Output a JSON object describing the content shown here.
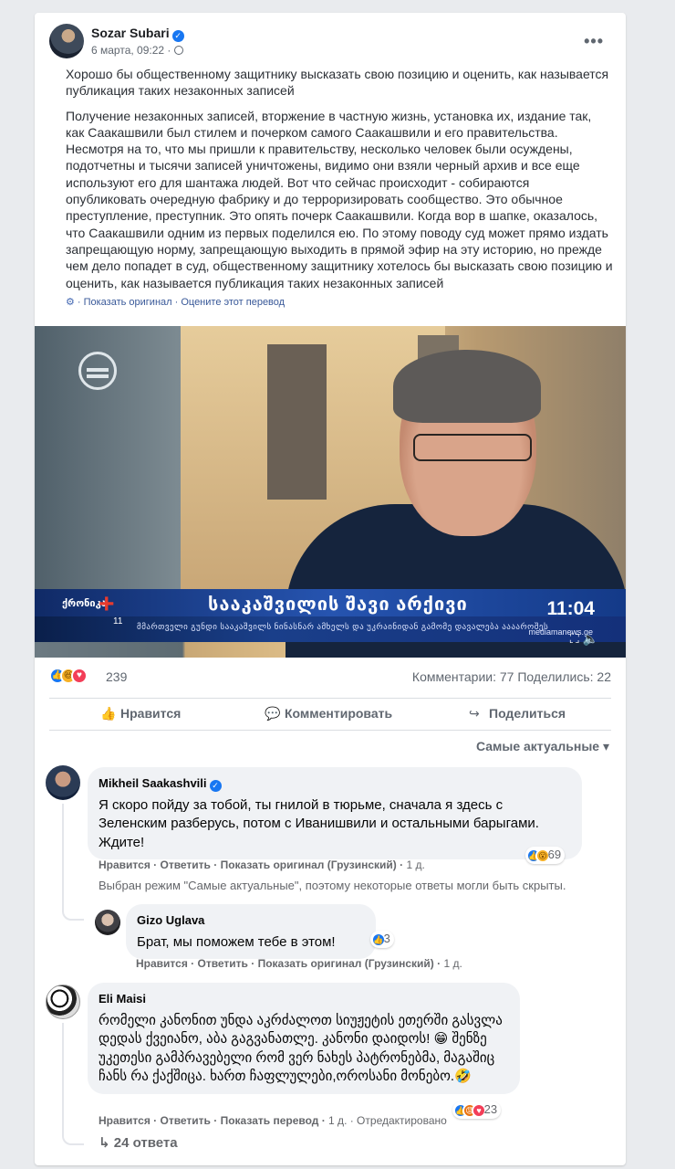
{
  "post": {
    "author": "Sozar Subari",
    "date": "6 марта, 09:22 ·",
    "more": "•••",
    "paragraph1": "Хорошо бы общественному защитнику высказать свою позицию и оценить, как называется публикация таких незаконных записей",
    "paragraph2": "Получение незаконных записей, вторжение в частную жизнь, установка их, издание так, как Саакашвили был стилем и почерком самого Саакашвили и его правительства. Несмотря на то, что мы пришли к правительству, несколько человек были осуждены, подотчетны и тысячи записей уничтожены, видимо они взяли черный архив и все еще используют его для шантажа людей. Вот что сейчас происходит - собираются опубликовать очередную фабрику и до терроризировать сообщество. Это обычное преступление, преступник. Это опять почерк Саакашвили. Когда вор в шапке, оказалось, что Саакашвили одним из первых поделился ею. По этому поводу суд может прямо издать запрещающую норму, запрещающую выходить в прямой эфир на эту историю, но прежде чем дело попадет в суд, общественному защитнику хотелось бы высказать свою позицию и оценить, как называется публикация таких незаконных записей",
    "show_original": "· Показать оригинал · Оцените этот перевод"
  },
  "video": {
    "brand": "ქრონიკა",
    "plus": "+",
    "channel": "11",
    "headline": "სააკაშვილის შავი არქივი",
    "subline": "მმართველი გუნდი სააკაშვილს ნინასნარ ამხელს და უკრაინიდან გამომე დავალება ააააროშეს",
    "time": "11:04",
    "watermark": "mediamanews.ge"
  },
  "stats": {
    "reactions": "239",
    "comments_shares": "Комментарии: 77  Поделились: 22"
  },
  "actions": {
    "like": "Нравится",
    "comment": "Комментировать",
    "share": "Поделиться"
  },
  "sort": "Самые актуальные ▾",
  "comments": [
    {
      "name": "Mikheil Saakashvili",
      "text": "Я скоро пойду за тобой, ты гнилой в тюрьме, сначала я здесь с Зеленским разберусь, потом с Иванишвили и остальными барыгами. Ждите!",
      "actions": "Нравится · Ответить · Показать оригинал (Грузинский) ·",
      "time": " 1 д.",
      "reactions": "69"
    },
    {
      "name": "Gizo Uglava",
      "text": "Брат, мы поможем тебе в этом!",
      "actions": "Нравится · Ответить · Показать оригинал (Грузинский) ·",
      "time": " 1 д.",
      "reactions": "3"
    },
    {
      "name": "Eli Maisi",
      "text": "რომელი კანონით უნდა აკრძალოთ სიუჟეტის ეთერში გასვლა დედას ქვეიანო, აბა გაგვანათლე. კანონი დაიდოს! 😁 შენზე უკეთესი გამპრავებელი რომ ვერ ნახეს პატრონებმა, მაგაშიც ჩანს რა ქაქშიცა. ხართ ჩაფლულები,ოროსანი მონებო.🤣",
      "actions": "Нравится · Ответить · Показать перевод ·",
      "time": " 1 д. · Отредактировано",
      "reactions": "23"
    }
  ],
  "filter_note": "Выбран режим \"Самые актуальные\", поэтому некоторые ответы могли быть скрыты.",
  "replies": "↳ 24 ответа",
  "colors": {
    "accent": "#1877f2",
    "link": "#385898",
    "muted": "#65676b",
    "bubble": "#f0f2f5"
  }
}
